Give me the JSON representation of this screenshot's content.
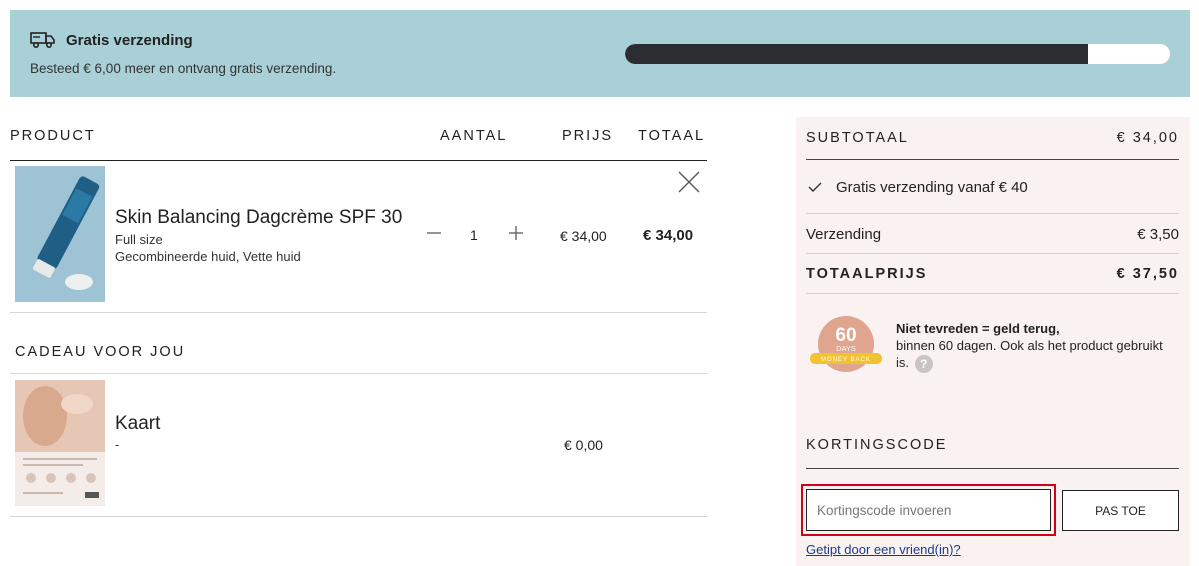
{
  "banner": {
    "title": "Gratis verzending",
    "subtitle": "Besteed € 6,00 meer en ontvang gratis verzending.",
    "progress_fraction": 0.85,
    "icon": "truck-icon"
  },
  "table": {
    "headers": {
      "product": "PRODUCT",
      "quantity": "AANTAL",
      "price": "PRIJS",
      "total": "TOTAAL"
    }
  },
  "item": {
    "name": "Skin Balancing Dagcrème SPF 30",
    "size": "Full size",
    "skin_type": "Gecombineerde huid, Vette huid",
    "quantity": "1",
    "price": "€ 34,00",
    "total": "€ 34,00"
  },
  "gift": {
    "section_title": "CADEAU VOOR JOU",
    "name": "Kaart",
    "meta": "-",
    "price": "€ 0,00"
  },
  "summary": {
    "subtotal_label": "SUBTOTAAL",
    "subtotal_value": "€ 34,00",
    "free_shipping_note": "Gratis verzending vanaf € 40",
    "shipping_label": "Verzending",
    "shipping_value": "€ 3,50",
    "total_label": "TOTAALPRIJS",
    "total_value": "€ 37,50"
  },
  "money_back": {
    "badge_number": "60",
    "badge_days": "DAYS",
    "badge_ribbon": "MONEY BACK",
    "heading": "Niet tevreden = geld terug,",
    "body": "binnen 60 dagen. Ook als het product gebruikt is.",
    "help": "?"
  },
  "discount": {
    "title": "KORTINGSCODE",
    "placeholder": "Kortingscode invoeren",
    "value": "",
    "apply_label": "PAS TOE",
    "friend_link": "Getipt door een vriend(in)?"
  },
  "colors": {
    "banner_bg": "#a8d0d6",
    "progress_fill": "#2b2d30",
    "summary_bg": "#f9f2f1",
    "focus_outline": "#d0021b",
    "badge_circle": "#e0a58e",
    "badge_ribbon": "#f2c230"
  }
}
